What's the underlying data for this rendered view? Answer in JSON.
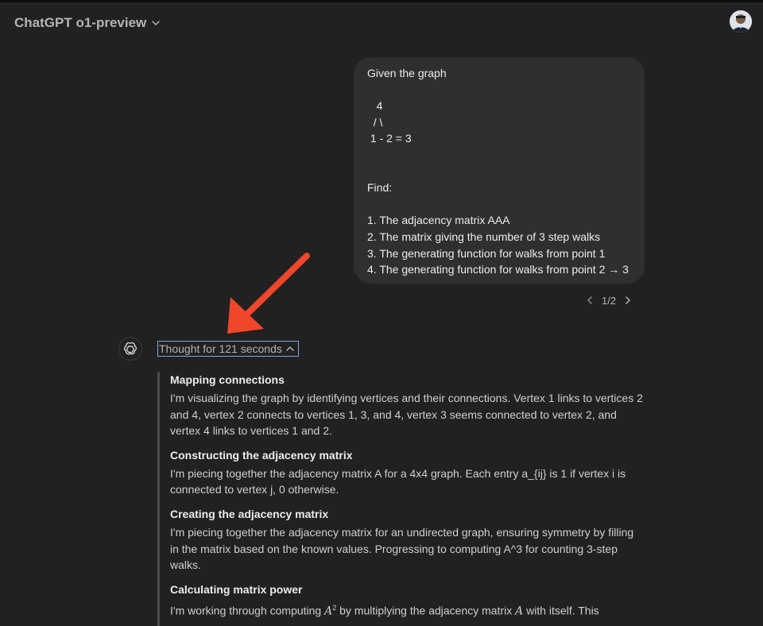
{
  "header": {
    "model_label": "ChatGPT o1-preview",
    "dropdown_icon": "chevron-down-icon"
  },
  "user_message": {
    "text": "Given the graph\n\n   4\n  / \\\n 1 - 2 = 3\n\n\nFind:\n\n1. The adjacency matrix AAA\n2. The matrix giving the number of 3 step walks\n3. The generating function for walks from point 1\n4. The generating function for walks from point 2 → 3"
  },
  "pager": {
    "current": "1/2"
  },
  "assistant": {
    "thought_label": "Thought for 121 seconds",
    "steps": [
      {
        "title": "Mapping connections",
        "body": "I'm visualizing the graph by identifying vertices and their connections. Vertex 1 links to vertices 2 and 4, vertex 2 connects to vertices 1, 3, and 4, vertex 3 seems connected to vertex 2, and vertex 4 links to vertices 1 and 2."
      },
      {
        "title": "Constructing the adjacency matrix",
        "body": "I'm piecing together the adjacency matrix A for a 4x4 graph. Each entry a_{ij} is 1 if vertex i is connected to vertex j, 0 otherwise."
      },
      {
        "title": "Creating the adjacency matrix",
        "body": "I'm piecing together the adjacency matrix for an undirected graph, ensuring symmetry by filling in the matrix based on the known values. Progressing to computing A^3 for counting 3-step walks."
      },
      {
        "title": "Calculating matrix power",
        "body_pre": "I'm working through computing ",
        "body_math1": "A",
        "body_sup": "2",
        "body_mid": " by multiplying the adjacency matrix ",
        "body_math2": "A",
        "body_post": " with itself. This"
      }
    ]
  },
  "colors": {
    "background": "#212121",
    "bubble": "#2f2f2f",
    "annotation_arrow": "#f0462a",
    "focus_outline": "#7aa7e0"
  }
}
